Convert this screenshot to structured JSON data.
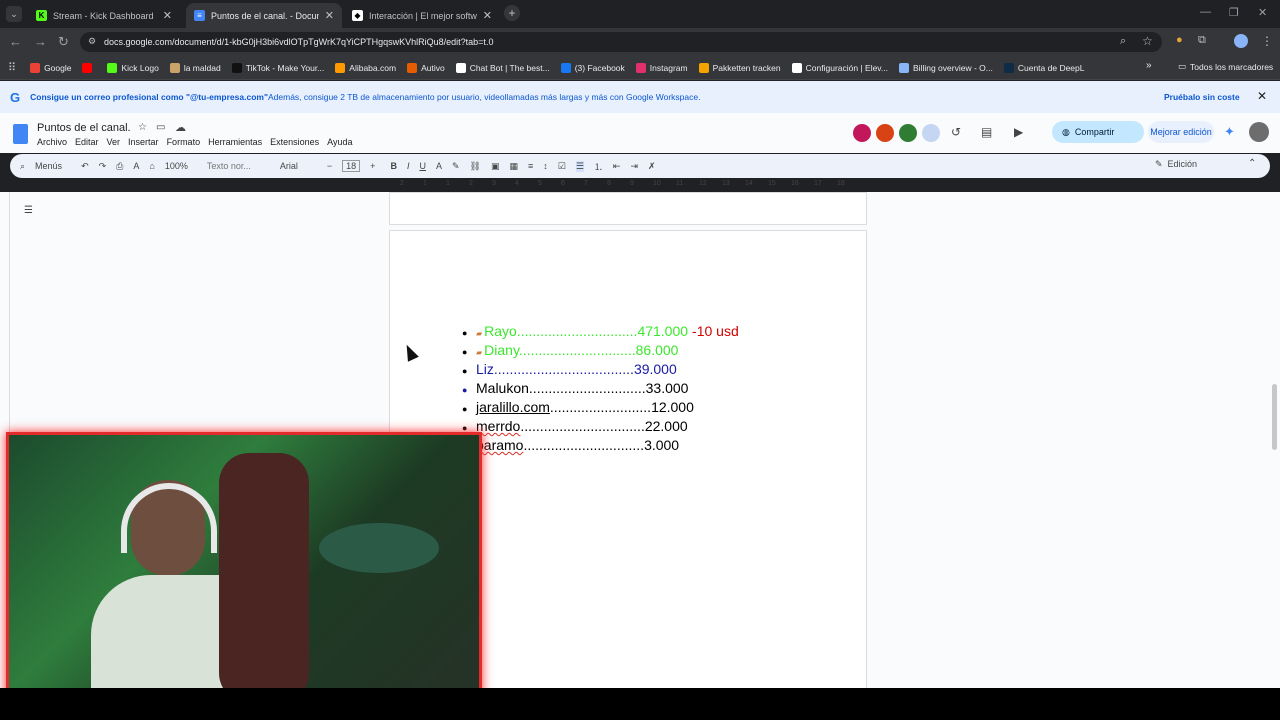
{
  "tabs": [
    {
      "title": "Stream - Kick Dashboard",
      "fav": "K",
      "favColor": "#53fc18"
    },
    {
      "title": "Puntos de el canal. - Document",
      "fav": "≡",
      "favColor": "#4285f4"
    },
    {
      "title": "Interacción | El mejor software",
      "fav": "◆",
      "favColor": "#ffffff"
    }
  ],
  "address": {
    "url": "docs.google.com/document/d/1-kbG0jH3bi6vdlOTpTgWrK7qYiCPTHgqswKVhlRiQu8/edit?tab=t.0"
  },
  "bookmarks": [
    {
      "label": "Google",
      "color": "#ea4335"
    },
    {
      "label": "",
      "color": "#ff0000"
    },
    {
      "label": "Kick Logo",
      "color": "#53fc18"
    },
    {
      "label": "la maldad",
      "color": "#c9a36a"
    },
    {
      "label": "TikTok - Make Your...",
      "color": "#111111"
    },
    {
      "label": "Alibaba.com",
      "color": "#ff9900"
    },
    {
      "label": "Autivo",
      "color": "#e65c00"
    },
    {
      "label": "Chat Bot | The best...",
      "color": "#ffffff"
    },
    {
      "label": "(3) Facebook",
      "color": "#1877f2"
    },
    {
      "label": "Instagram",
      "color": "#e1306c"
    },
    {
      "label": "Pakketten tracken",
      "color": "#f4a300"
    },
    {
      "label": "Configuración | Elev...",
      "color": "#ffffff"
    },
    {
      "label": "Billing overview - O...",
      "color": "#8ab4f8"
    },
    {
      "label": "Cuenta de DeepL",
      "color": "#0f2b46"
    }
  ],
  "bookmarks_all": "Todos los marcadores",
  "banner": {
    "bold": "Consigue un correo profesional como \"@tu-empresa.com\"",
    "rest": " Además, consigue 2 TB de almacenamiento por usuario, videollamadas más largas y más con Google Workspace.",
    "cta": "Pruébalo sin coste"
  },
  "doc": {
    "title": "Puntos de el canal.",
    "menus": [
      "Archivo",
      "Editar",
      "Ver",
      "Insertar",
      "Formato",
      "Herramientas",
      "Extensiones",
      "Ayuda"
    ],
    "share": "Compartir",
    "upgrade": "Mejorar edición"
  },
  "toolbar": {
    "search": "Menús",
    "zoom": "100%",
    "style": "Texto nor...",
    "font": "Arial",
    "size": "18",
    "mode": "Edición"
  },
  "ruler": [
    "2",
    "1",
    "1",
    "2",
    "3",
    "4",
    "5",
    "6",
    "7",
    "8",
    "9",
    "10",
    "11",
    "12",
    "13",
    "14",
    "15",
    "16",
    "17",
    "18"
  ],
  "list": [
    {
      "name": "Rayo",
      "dots": "...............................",
      "value": "471.000",
      "extra": "-10 usd",
      "color": "#3ce62e",
      "icon": true
    },
    {
      "name": "Diany",
      "dots": "..............................",
      "value": "86.000",
      "extra": "",
      "color": "#3ce62e",
      "icon": true
    },
    {
      "name": "Liz",
      "dots": "....................................",
      "value": "39.000",
      "extra": "",
      "color": "#1a1aa6",
      "icon": false
    },
    {
      "name": "Malukon",
      "dots": "..............................",
      "value": "33.000",
      "extra": "",
      "color": "#000000",
      "icon": false
    },
    {
      "name": "jaralillo.com",
      "dots": "..........................",
      "value": "12.000",
      "extra": "",
      "color": "#000000",
      "icon": false
    },
    {
      "name": "merrdo",
      "dots": "................................",
      "value": "22.000",
      "extra": "",
      "color": "#000000",
      "icon": false
    },
    {
      "name": "paramo",
      "dots": "...............................",
      "value": "3.000",
      "extra": "",
      "color": "#000000",
      "icon": false
    }
  ]
}
